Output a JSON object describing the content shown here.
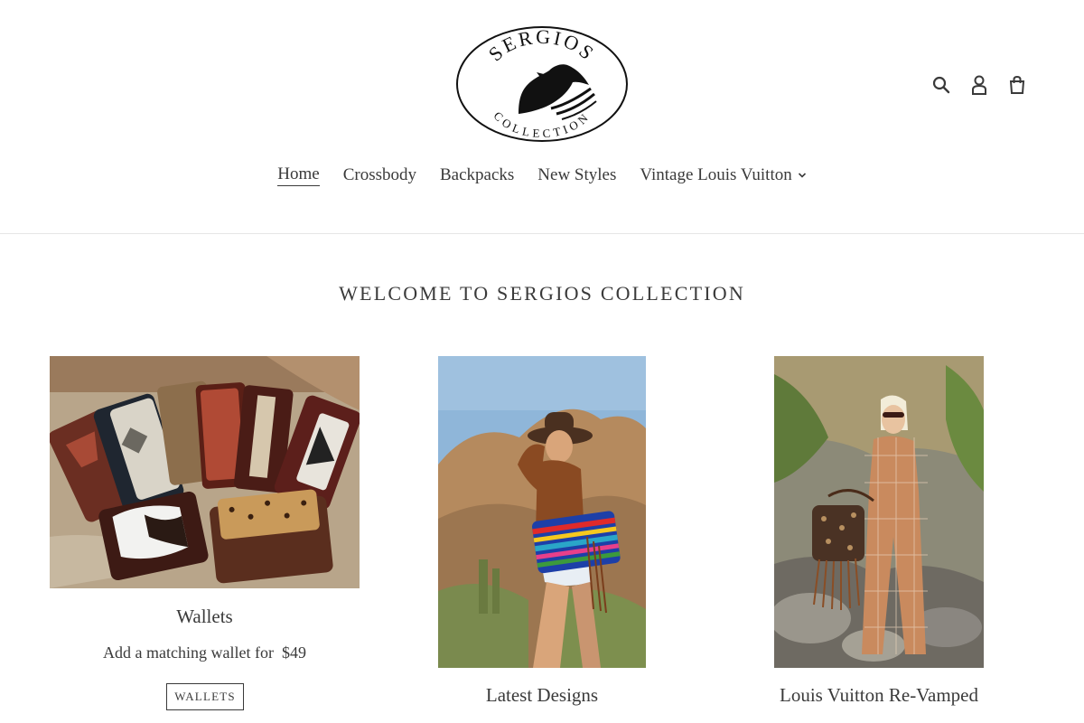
{
  "brand": {
    "logo_top": "SERGIOS",
    "logo_bottom": "COLLECTION"
  },
  "header": {
    "icons": [
      "search-icon",
      "account-icon",
      "cart-icon"
    ]
  },
  "nav": {
    "items": [
      {
        "label": "Home",
        "active": true
      },
      {
        "label": "Crossbody"
      },
      {
        "label": "Backpacks"
      },
      {
        "label": "New Styles"
      },
      {
        "label": "Vintage Louis Vuitton",
        "has_dropdown": true
      }
    ]
  },
  "main": {
    "heading": "WELCOME TO SERGIOS COLLECTION",
    "cards": [
      {
        "title": "Wallets",
        "subtitle": "Add a matching wallet for  $49",
        "button": "WALLETS"
      },
      {
        "title": "Latest Designs"
      },
      {
        "title": "Louis Vuitton Re-Vamped"
      }
    ]
  },
  "colors": {
    "text": "#3a3a3a",
    "border": "#e6e6e6"
  }
}
